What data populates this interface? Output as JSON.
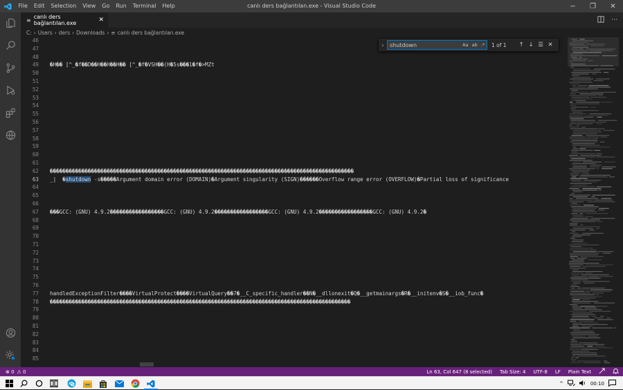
{
  "titlebar": {
    "menu": [
      "File",
      "Edit",
      "Selection",
      "View",
      "Go",
      "Run",
      "Terminal",
      "Help"
    ],
    "title": "canlı ders bağlantılan.exe - Visual Studio Code",
    "minimize": "−",
    "restore": "❐",
    "close": "✕"
  },
  "tab": {
    "label": "canlı ders bağlantılan.exe",
    "close": "✕"
  },
  "breadcrumb": [
    "C:",
    "Users",
    "ders",
    "Downloads",
    "canlı ders bağlantılan.exe"
  ],
  "find": {
    "query": "shutdown",
    "match_case": "Aa",
    "whole_word": "ab",
    "regex": ".*",
    "count": "1 of 1",
    "prev": "↑",
    "next": "↓",
    "in_selection": "☰",
    "close": "✕"
  },
  "editor": {
    "lines": [
      {
        "n": "46",
        "t": ""
      },
      {
        "n": "47",
        "t": ""
      },
      {
        "n": "48",
        "t": ""
      },
      {
        "n": "49",
        "t": "�H�� [^_�f��D��H��H��H�� [^_�f�VSH��(H�5s���1�f�>MZt"
      },
      {
        "n": "50",
        "t": ""
      },
      {
        "n": "51",
        "t": ""
      },
      {
        "n": "52",
        "t": ""
      },
      {
        "n": "53",
        "t": ""
      },
      {
        "n": "54",
        "t": ""
      },
      {
        "n": "55",
        "t": ""
      },
      {
        "n": "56",
        "t": ""
      },
      {
        "n": "57",
        "t": ""
      },
      {
        "n": "58",
        "t": ""
      },
      {
        "n": "59",
        "t": ""
      },
      {
        "n": "60",
        "t": ""
      },
      {
        "n": "61",
        "t": ""
      },
      {
        "n": "62",
        "t": "������������������������������������������������������������������������������������������������"
      },
      {
        "n": "63",
        "t": "_|  �",
        "match": "shutdown",
        "after": " -s�����Argument domain error (DOMAIN)�Argument singularity (SIGN)������Overflow range error (OVERFLOW)�Partial loss of significance"
      },
      {
        "n": "64",
        "t": ""
      },
      {
        "n": "65",
        "t": ""
      },
      {
        "n": "66",
        "t": ""
      },
      {
        "n": "67",
        "t": "���GCC: (GNU) 4.9.2�����������������GCC: (GNU) 4.9.2�����������������GCC: (GNU) 4.9.2�����������������GCC: (GNU) 4.9.2�"
      },
      {
        "n": "68",
        "t": ""
      },
      {
        "n": "69",
        "t": ""
      },
      {
        "n": "70",
        "t": ""
      },
      {
        "n": "71",
        "t": ""
      },
      {
        "n": "72",
        "t": ""
      },
      {
        "n": "73",
        "t": ""
      },
      {
        "n": "74",
        "t": ""
      },
      {
        "n": "75",
        "t": ""
      },
      {
        "n": "76",
        "t": ""
      },
      {
        "n": "77",
        "t": "handledExceptionFilter����VirtualProtect����VirtualQuery��7�__C_specific_handler��N�__dllonexit�Q�__getmainargs�R�__initenv�S�__iob_func�"
      },
      {
        "n": "78",
        "t": "�����������������������������������������������������������������������������������������������"
      },
      {
        "n": "79",
        "t": ""
      },
      {
        "n": "80",
        "t": ""
      },
      {
        "n": "81",
        "t": ""
      },
      {
        "n": "82",
        "t": ""
      },
      {
        "n": "83",
        "t": ""
      },
      {
        "n": "84",
        "t": ""
      },
      {
        "n": "85",
        "t": ""
      }
    ]
  },
  "statusbar": {
    "errors": "⊗ 0",
    "warnings": "⚠ 0",
    "position": "Ln 63, Col 647 (8 selected)",
    "tab_size": "Tab Size: 4",
    "encoding": "UTF-8",
    "eol": "LF",
    "language": "Plain Text"
  },
  "taskbar": {
    "time": "00:10"
  },
  "colors": {
    "status": "#68217a",
    "accent": "#007acc",
    "titlebar": "#3c3c3c",
    "activity": "#333333",
    "editor": "#1e1e1e"
  },
  "icons": [
    "explorer-icon",
    "search-icon",
    "source-control-icon",
    "run-debug-icon",
    "extensions-icon",
    "remote-icon",
    "account-icon",
    "manage-icon"
  ]
}
